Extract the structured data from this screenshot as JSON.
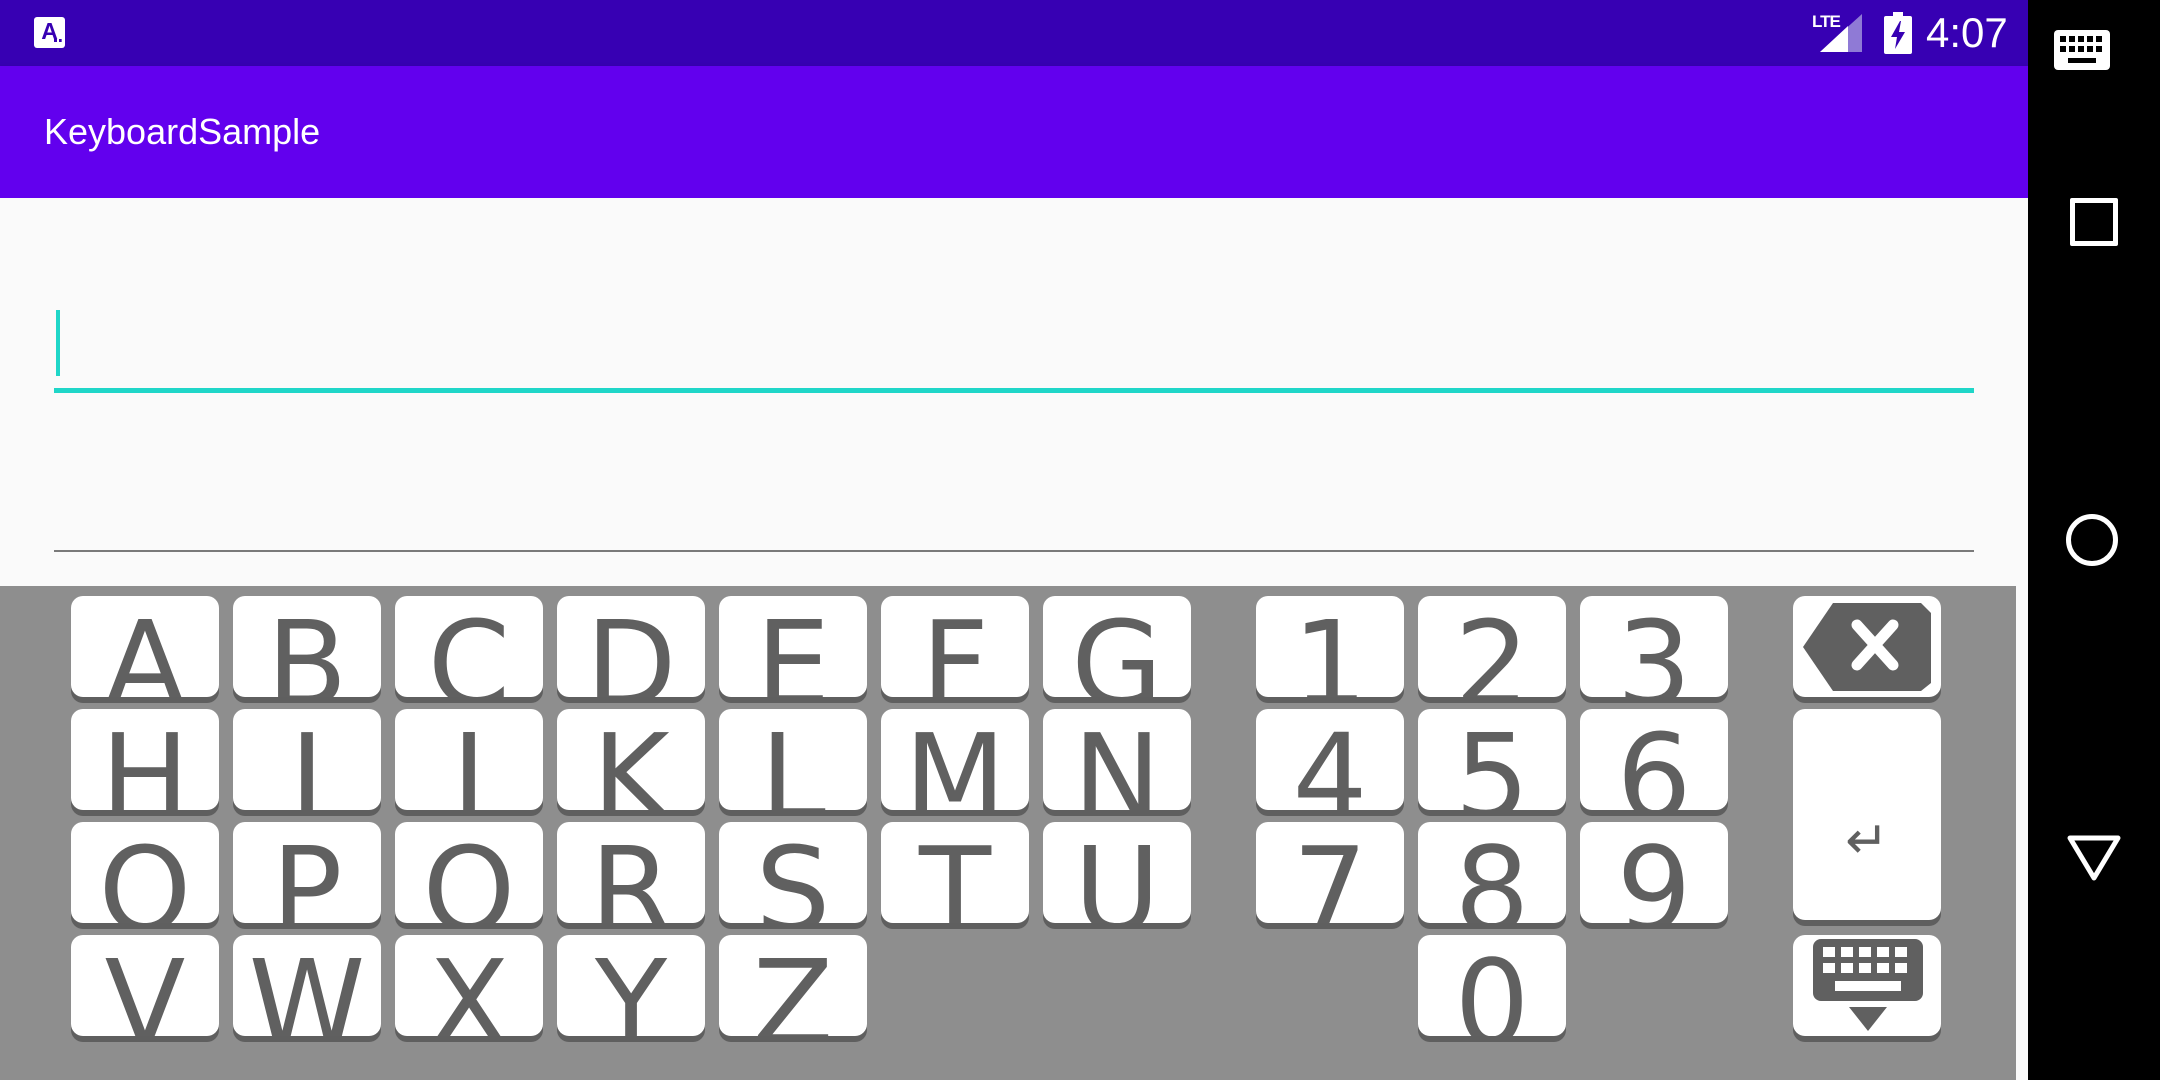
{
  "status_bar": {
    "background": "#3700b3",
    "notification_icon": "app-notification-icon",
    "notification_letter": "A",
    "network_type": "LTE",
    "signal_icon": "cell-signal-icon",
    "battery_icon": "battery-charging-icon",
    "time": "4:07"
  },
  "app_bar": {
    "background": "#6200ee",
    "title": "KeyboardSample"
  },
  "content": {
    "text_fields": [
      {
        "value": "",
        "focused": true,
        "accent_color": "#1fd6c8"
      },
      {
        "value": "",
        "focused": false
      }
    ]
  },
  "keyboard": {
    "background": "#8e8e8e",
    "letter_keys": [
      "A",
      "B",
      "C",
      "D",
      "E",
      "F",
      "G",
      "H",
      "I",
      "J",
      "K",
      "L",
      "M",
      "N",
      "O",
      "P",
      "Q",
      "R",
      "S",
      "T",
      "U",
      "V",
      "W",
      "X",
      "Y",
      "Z"
    ],
    "number_keys": [
      "1",
      "2",
      "3",
      "4",
      "5",
      "6",
      "7",
      "8",
      "9",
      "0"
    ],
    "backspace_icon": "backspace-icon",
    "enter_icon": "enter-return-icon",
    "enter_label": "↵",
    "hide_keyboard_icon": "keyboard-hide-icon"
  },
  "nav_bar": {
    "background": "#000000",
    "keyboard_switch_icon": "keyboard-icon",
    "recents_icon": "square-icon",
    "home_icon": "circle-icon",
    "back_icon": "triangle-back-icon"
  }
}
